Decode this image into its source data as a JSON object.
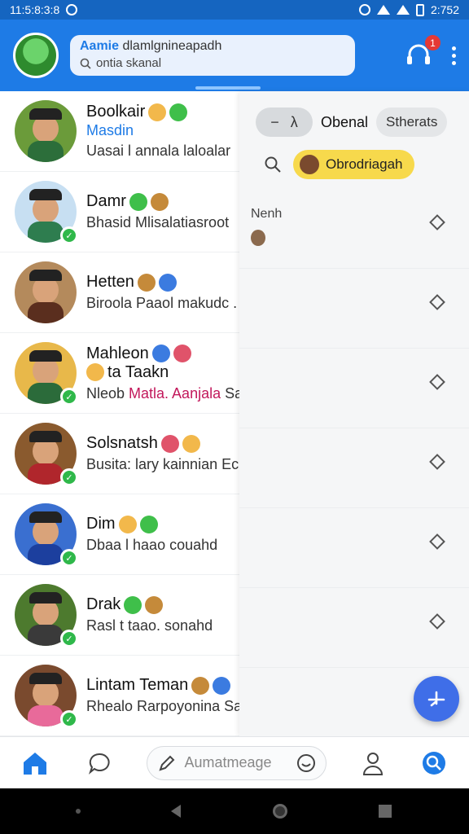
{
  "status_bar": {
    "time_left": "11:5:8:3:8",
    "time_right": "2:752"
  },
  "header": {
    "search_line1_highlight": "Aamie",
    "search_line1_rest": " dlamlgnineapadh",
    "search_line2": "ontia skanal",
    "notification_count": "1"
  },
  "chats": [
    {
      "name": "Boolkair",
      "sub": "Masdin",
      "preview": "Uasai l annala laloalar",
      "preview_highlight": "",
      "avatar_bg": "#6b9b3a",
      "shirt": "#2c6e3a",
      "online": false
    },
    {
      "name": "Damr",
      "sub": "",
      "preview": "Bhasid Mlisalatiasroot",
      "preview_highlight": "",
      "avatar_bg": "#c7dff2",
      "shirt": "#2e7d4f",
      "online": true
    },
    {
      "name": "Hetten",
      "sub": "",
      "preview": "Biroola Paaol makudc .",
      "preview_highlight": "",
      "avatar_bg": "#b48a5c",
      "shirt": "#5a2e1e",
      "online": false
    },
    {
      "name": "Mahleon",
      "sub": "",
      "name_line2": "ta Taakn",
      "preview": "Nleob ",
      "preview_highlight": "Matla. Aanjala",
      "preview_tail": " Sa",
      "avatar_bg": "#e8b84a",
      "shirt": "#2b6b3a",
      "online": true
    },
    {
      "name": "Solsnatsh",
      "sub": "",
      "preview": "Busita: lary kainnian Ec",
      "preview_highlight": "",
      "avatar_bg": "#8a5a2e",
      "shirt": "#b0262c",
      "online": true
    },
    {
      "name": "Dim",
      "sub": "",
      "preview": "Dbaa l haao couahd",
      "preview_highlight": "",
      "avatar_bg": "#3a6fd0",
      "shirt": "#1c3f9e",
      "online": true
    },
    {
      "name": "Drak",
      "sub": "",
      "preview": "Rasl t taao. sonahd",
      "preview_highlight": "",
      "avatar_bg": "#4d7a2e",
      "shirt": "#3a3a3a",
      "online": true
    },
    {
      "name": "Lintam Teman",
      "sub": "",
      "preview": "Rhealo Rarpoyonina Sa",
      "preview_highlight": "",
      "avatar_bg": "#7a4a2e",
      "shirt": "#e86a9a",
      "online": true
    }
  ],
  "panel": {
    "seg_left": "−",
    "seg_right": "λ",
    "label": "Obenal",
    "pill": "Stherats",
    "chip": "Obrodriagah",
    "row1_label": "Nenh"
  },
  "bottom_nav": {
    "compose_placeholder": "Aumatmeage"
  },
  "colors": {
    "primary": "#1e7be6",
    "online": "#2fb84a",
    "chip": "#f7d94c",
    "badge": "#e53935"
  }
}
